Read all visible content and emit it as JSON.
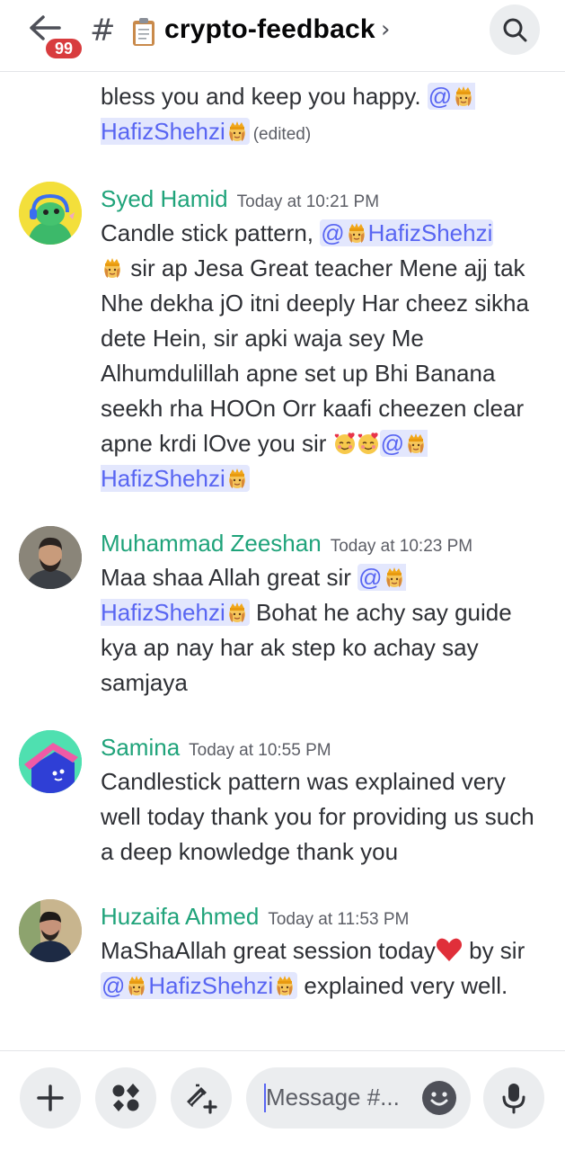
{
  "header": {
    "badge_count": "99",
    "hash_symbol": "#",
    "channel_emoji": "clipboard-icon",
    "channel_name": "crypto-feedback",
    "chevron": "›"
  },
  "messages": [
    {
      "partial": true,
      "line1": "bless you and keep you happy. ",
      "mention_1": "@",
      "mention_2": "HafizShehzi",
      "edited": "(edited)"
    },
    {
      "author": "Syed Hamid",
      "time": "Today at 10:21 PM",
      "text_1": "Candle stick pattern, ",
      "mention_a": "@",
      "mention_b": "HafizShehzi",
      "text_2": " sir ap Jesa Great teacher Mene ajj tak Nhe dekha jO itni deeply Har cheez sikha dete Hein, sir apki waja sey Me Alhumdulillah apne set up Bhi Banana seekh rha HOOn Orr kaafi cheezen clear apne krdi lOve you sir ",
      "mention_c": "@",
      "mention_d": "HafizShehzi"
    },
    {
      "author": "Muhammad Zeeshan",
      "time": "Today at 10:23 PM",
      "text_1": "Maa shaa Allah great sir ",
      "mention_a": "@",
      "mention_b": "HafizShehzi",
      "text_2": " Bohat he achy say guide kya ap nay har ak step ko achay say samjaya"
    },
    {
      "author": "Samina",
      "time": "Today at 10:55 PM",
      "text_1": "Candlestick pattern was explained very well today thank you for providing us such a deep knowledge thank you"
    },
    {
      "author": "Huzaifa Ahmed",
      "time": "Today at 11:53 PM",
      "text_1": "MaShaAllah great session today",
      "text_2": " by sir ",
      "mention_a": "@",
      "mention_b": "HafizShehzi",
      "text_3": " explained very well."
    }
  ],
  "composer": {
    "placeholder": "Message #..."
  },
  "colors": {
    "author": "#1fa37a",
    "mention_bg": "#e3e7fd",
    "mention_text": "#5865f2",
    "badge": "#d83c3e"
  }
}
